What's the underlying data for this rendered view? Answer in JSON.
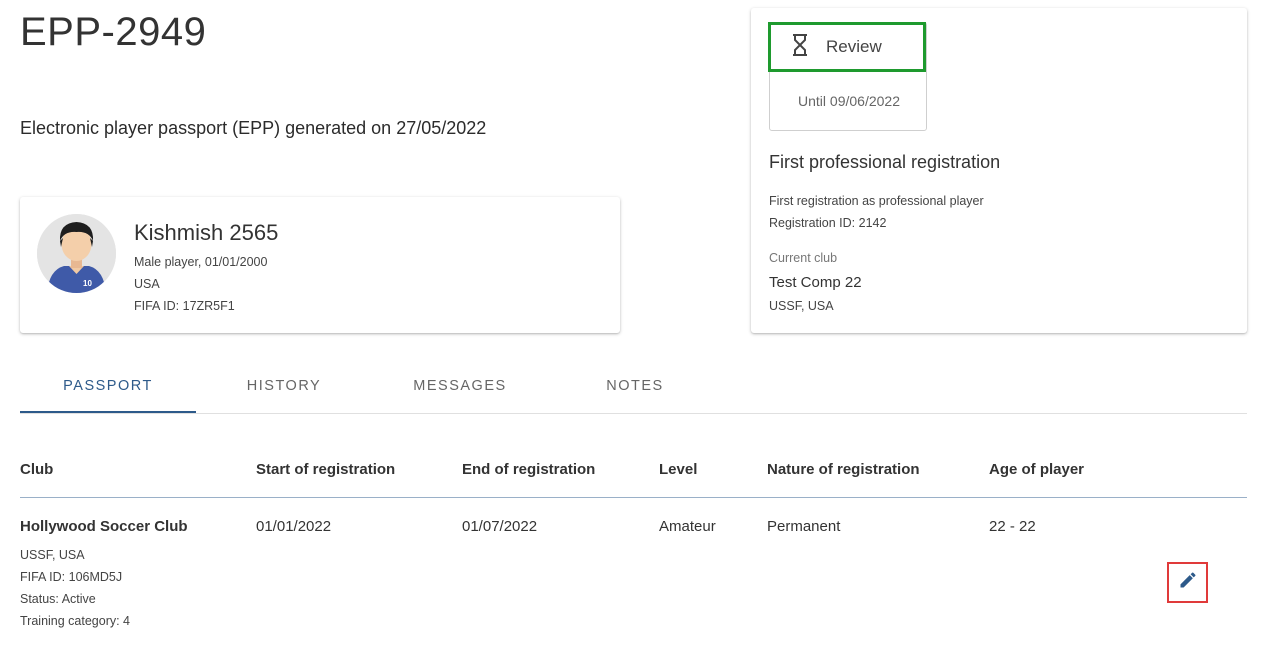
{
  "header": {
    "title": "EPP-2949",
    "subtitle": "Electronic player passport (EPP) generated on 27/05/2022"
  },
  "player": {
    "name": "Kishmish 2565",
    "details": "Male player, 01/01/2000",
    "country": "USA",
    "fifa_id": "FIFA ID: 17ZR5F1",
    "jersey_number": "10"
  },
  "status": {
    "review_label": "Review",
    "until": "Until 09/06/2022",
    "registration_title": "First professional registration",
    "registration_desc": "First registration as professional player",
    "registration_id": "Registration ID: 2142",
    "current_club_label": "Current club",
    "current_club": "Test Comp 22",
    "current_club_assoc": "USSF, USA"
  },
  "tabs": [
    {
      "label": "PASSPORT",
      "active": true
    },
    {
      "label": "HISTORY",
      "active": false
    },
    {
      "label": "MESSAGES",
      "active": false
    },
    {
      "label": "NOTES",
      "active": false
    }
  ],
  "table": {
    "columns": [
      "Club",
      "Start of registration",
      "End of registration",
      "Level",
      "Nature of registration",
      "Age of player"
    ],
    "rows": [
      {
        "club": "Hollywood Soccer Club",
        "club_assoc": "USSF, USA",
        "club_fifa_id": "FIFA ID: 106MD5J",
        "club_status": "Status: Active",
        "training_category": "Training category: 4",
        "start": "01/01/2022",
        "end": "01/07/2022",
        "level": "Amateur",
        "nature": "Permanent",
        "age": "22 - 22"
      }
    ]
  },
  "colors": {
    "accent": "#2d5a8a",
    "review_border": "#1e9a2e",
    "edit_highlight": "#e03a3a"
  },
  "icons": {
    "review": "hourglass-icon",
    "edit": "pencil-icon",
    "avatar": "player-avatar"
  }
}
